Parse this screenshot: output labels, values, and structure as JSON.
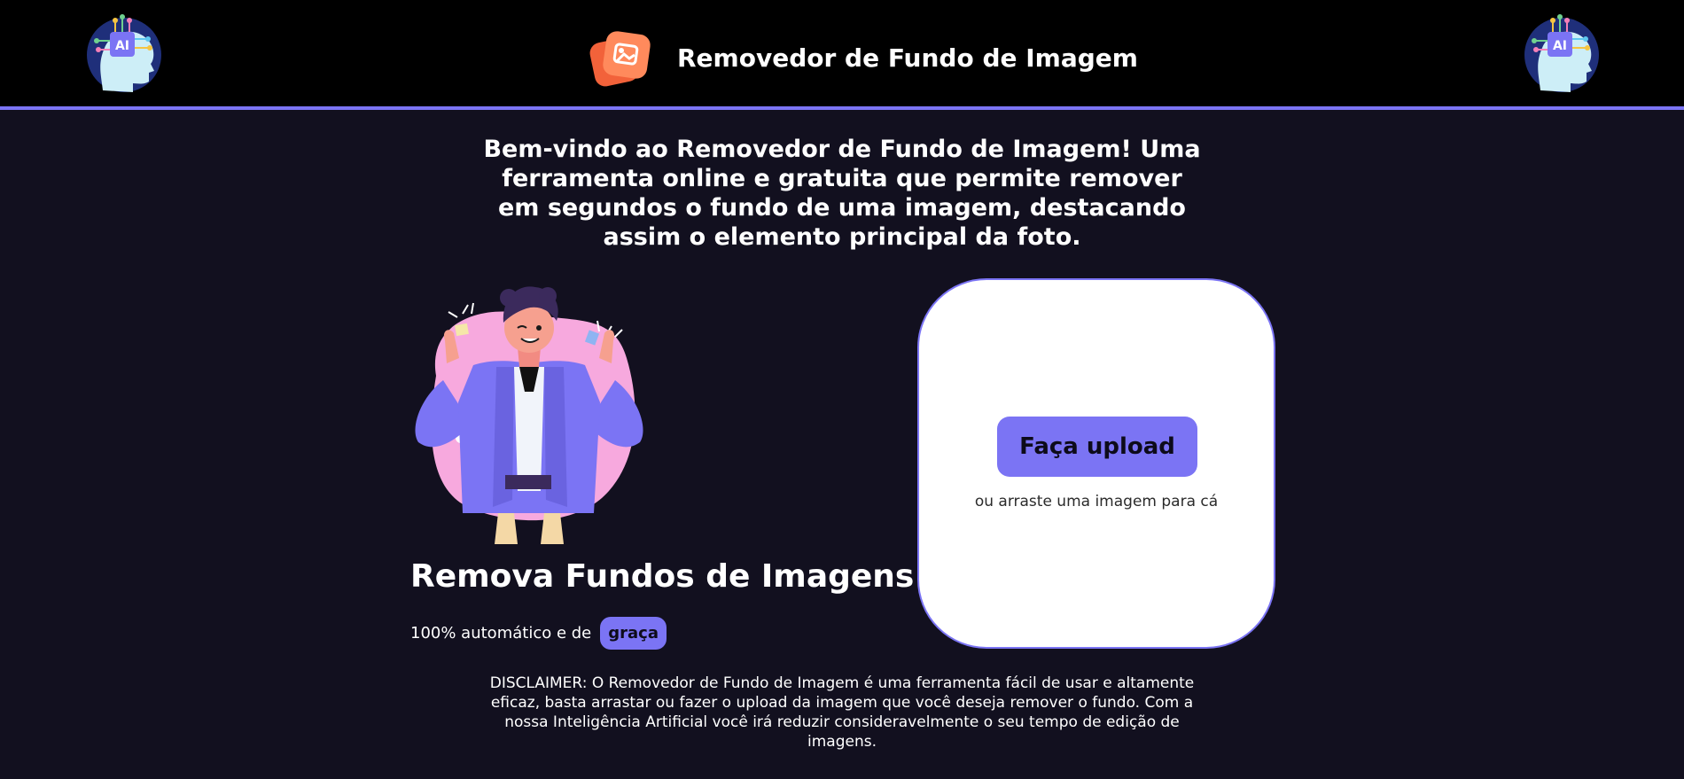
{
  "header": {
    "title": "Removedor de Fundo de Imagem",
    "logo_icon": "photo-stack-icon",
    "left_avatar_icon": "ai-brain-head-icon",
    "right_avatar_icon": "ai-brain-head-icon",
    "accent_color": "#7b74f4"
  },
  "main": {
    "welcome_text": "Bem-vindo ao Removedor de Fundo de Imagem! Uma ferramenta online e gratuita que permite remover em segundos o fundo de uma imagem, destacando assim o elemento principal da foto.",
    "hero_title": "Remova Fundos de Imagens",
    "auto_text": "100% automático e de",
    "free_badge": "graça",
    "illustration_icon": "thumbs-up-person-illustration"
  },
  "upload": {
    "button_label": "Faça upload",
    "drag_hint": "ou arraste uma imagem para cá"
  },
  "disclaimer": "DISCLAIMER: O Removedor de Fundo de Imagem é uma ferramenta fácil de usar e altamente eficaz, basta arrastar ou fazer o upload da imagem que você deseja remover o fundo. Com a nossa Inteligência Artificial você irá reduzir consideravelmente o seu tempo de edição de imagens.",
  "colors": {
    "page_background": "#12101f",
    "header_background": "#000000",
    "accent": "#7b74f4",
    "card_background": "#ffffff"
  }
}
